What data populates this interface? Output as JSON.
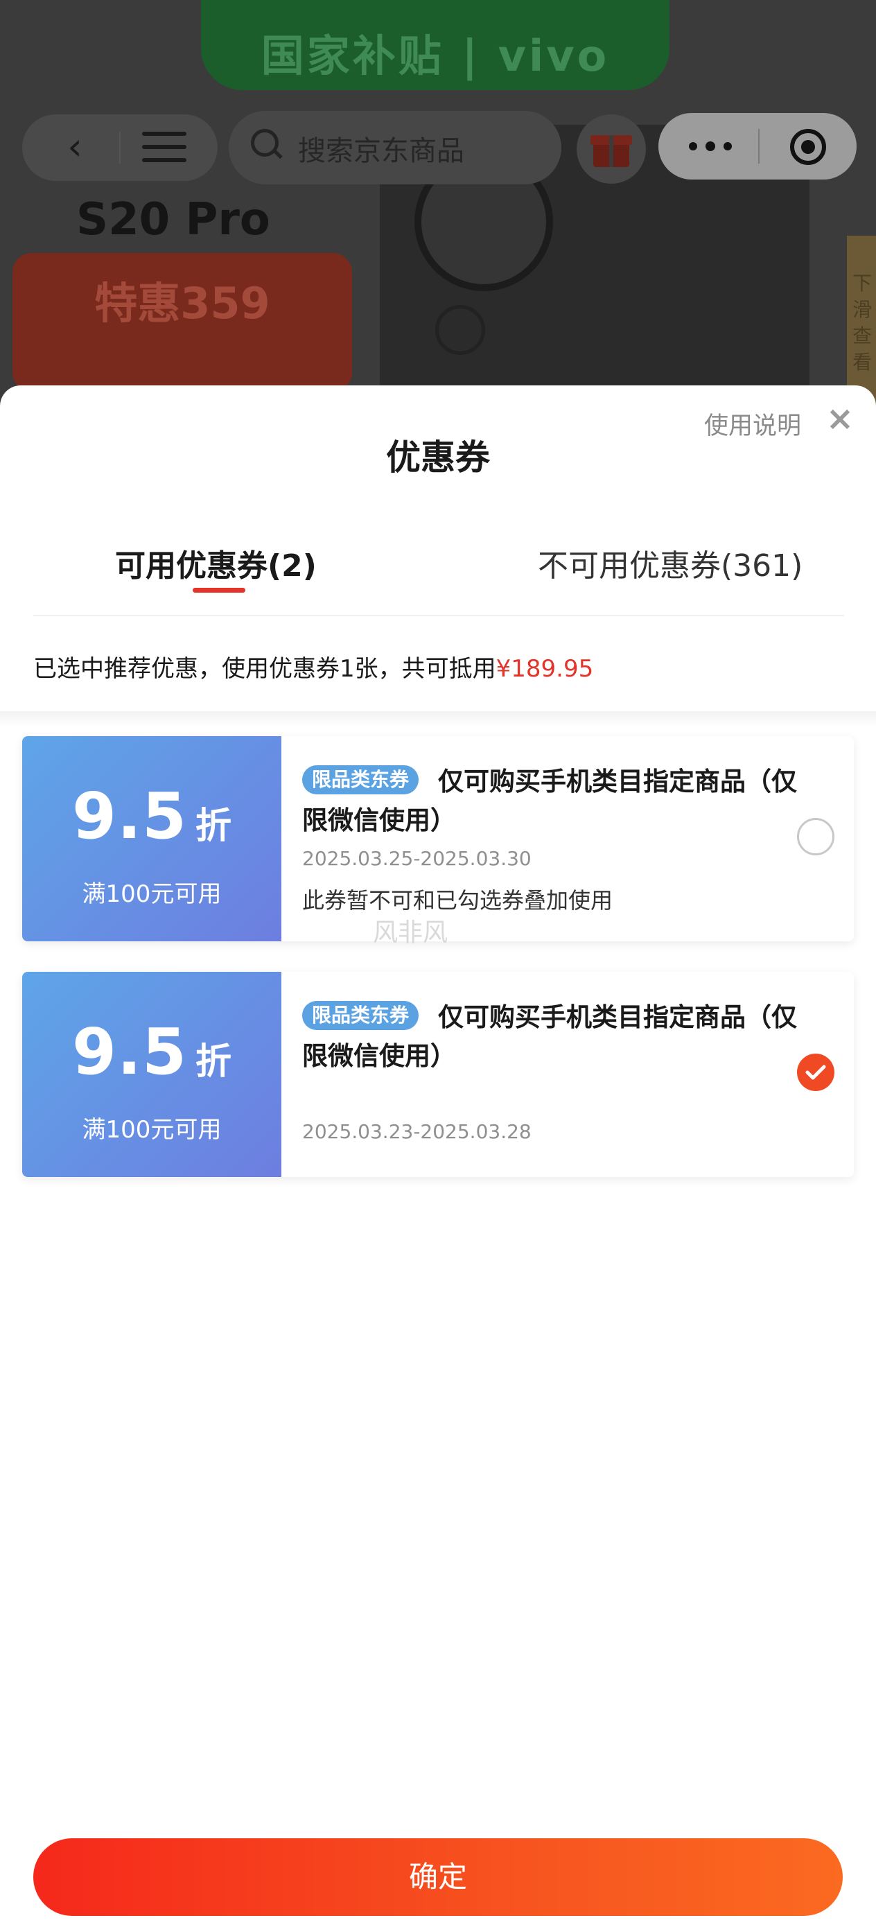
{
  "background": {
    "banner_text": "国家补贴 | vivo",
    "model": "S20 Pro",
    "promo": "特惠359",
    "side_hint": "下滑查看",
    "search_placeholder": "搜索京东商品"
  },
  "sheet": {
    "title": "优惠券",
    "help_label": "使用说明",
    "close_symbol": "×"
  },
  "tabs": [
    {
      "label": "可用优惠券(2)",
      "active": true
    },
    {
      "label": "不可用优惠券(361)",
      "active": false
    }
  ],
  "summary": {
    "text": "已选中推荐优惠，使用优惠券1张，共可抵用",
    "amount": "¥189.95"
  },
  "coupons": [
    {
      "discount": "9.5",
      "unit": "折",
      "condition": "满100元可用",
      "tag": "限品类东券",
      "title": "仅可购买手机类目指定商品（仅限微信使用）",
      "date": "2025.03.25-2025.03.30",
      "note": "此券暂不可和已勾选券叠加使用",
      "selected": false
    },
    {
      "discount": "9.5",
      "unit": "折",
      "condition": "满100元可用",
      "tag": "限品类东券",
      "title": "仅可购买手机类目指定商品（仅限微信使用）",
      "date": "2025.03.23-2025.03.28",
      "note": "",
      "selected": true
    }
  ],
  "watermark": "风非风",
  "confirm_label": "确定",
  "colors": {
    "accent": "#e4342a",
    "coupon_blue": "#5ea5e8",
    "check": "#f04a25"
  }
}
